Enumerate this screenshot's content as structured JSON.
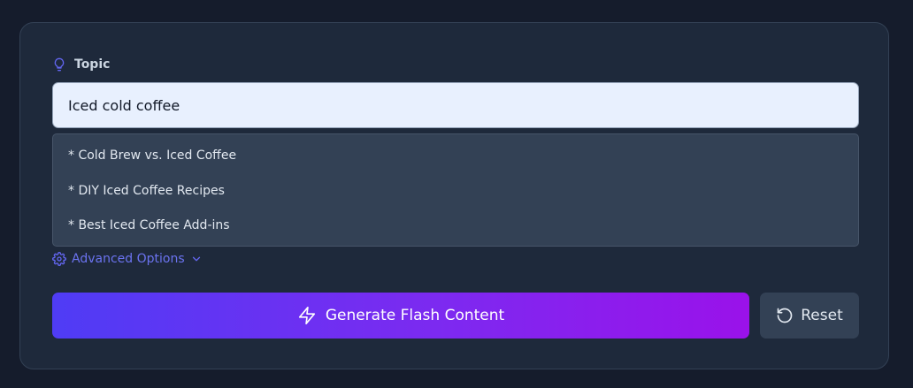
{
  "form": {
    "topic_label": "Topic",
    "topic_icon": "lightbulb-icon",
    "topic_value": "Iced cold coffee"
  },
  "suggestions": [
    "* Cold Brew vs. Iced Coffee",
    "* DIY Iced Coffee Recipes",
    "* Best Iced Coffee Add-ins"
  ],
  "advanced": {
    "label": "Advanced Options",
    "icon": "gear-icon",
    "chevron": "chevron-down-icon"
  },
  "actions": {
    "generate_label": "Generate Flash Content",
    "generate_icon": "lightning-icon",
    "reset_label": "Reset",
    "reset_icon": "rotate-ccw-icon"
  },
  "colors": {
    "page_background": "#151c2c",
    "card_background": "#1e293b",
    "accent": "#6366f1",
    "gradient_start": "#4f3cf5",
    "gradient_end": "#9a12ea",
    "secondary_button": "#334155"
  }
}
